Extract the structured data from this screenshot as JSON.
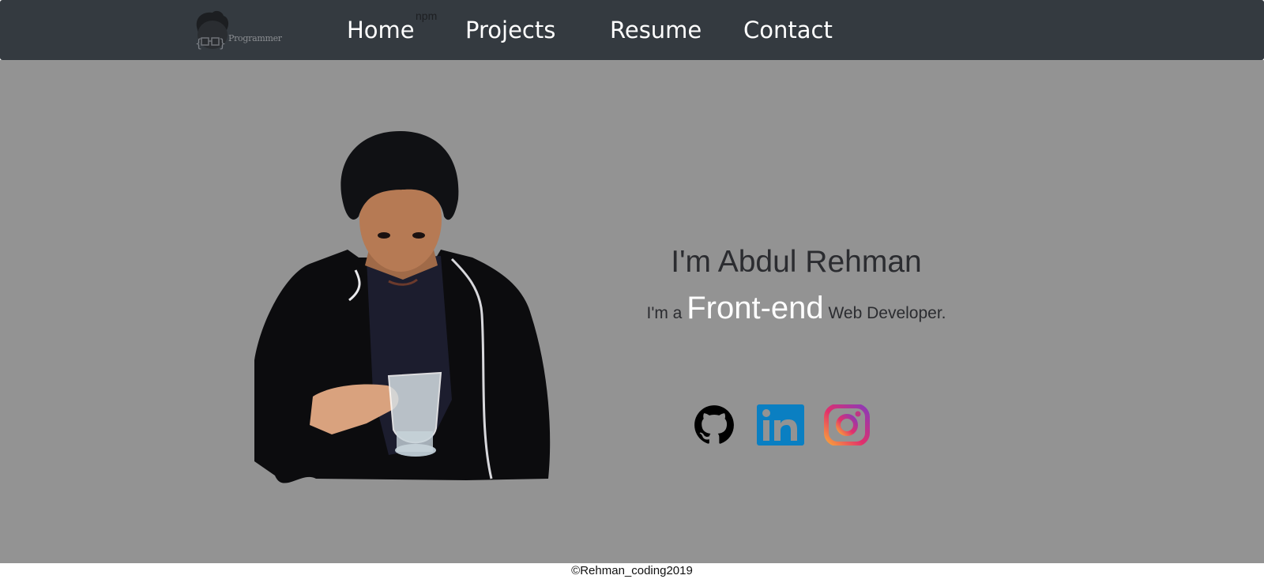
{
  "navbar": {
    "logo_text": "Programmer",
    "badge": "npm",
    "links": [
      "Home",
      "Projects",
      "Resume",
      "Contact"
    ]
  },
  "intro": {
    "name": "I'm Abdul Rehman",
    "role_prefix": "I'm a",
    "role_highlight": "Front-end",
    "role_suffix": "Web Developer."
  },
  "socials": {
    "items": [
      {
        "icon": "github-icon",
        "color": "#000000"
      },
      {
        "icon": "linkedin-icon",
        "color": "#0a7fc2"
      },
      {
        "icon": "instagram-icon",
        "color": "#c13584"
      }
    ]
  },
  "footer": {
    "copyright": "©Rehman_coding2019"
  },
  "colors": {
    "navbar_bg": "#343a40",
    "main_bg": "#939393",
    "footer_bg": "#ffffff"
  }
}
